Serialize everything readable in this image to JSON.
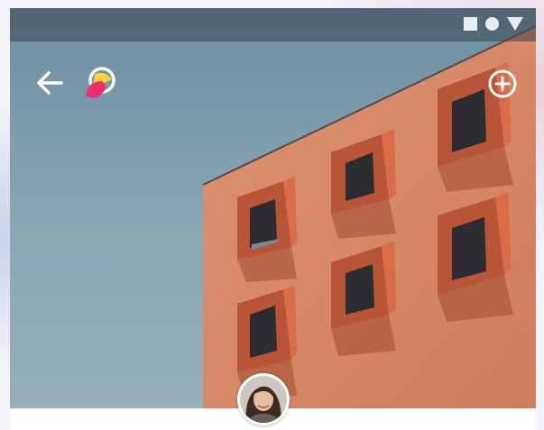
{
  "screen": {
    "title": ""
  },
  "status_bar": {
    "icons": [
      "square-icon",
      "circle-icon",
      "triangle-icon"
    ],
    "icon_color": "#e9eef2"
  },
  "toolbar": {
    "back_icon": "arrow-left-icon",
    "logo_icon": "brand-logo-icon",
    "add_icon": "plus-circle-icon"
  },
  "hero": {
    "image_description_icon": "building-photo",
    "sky_color": "#7d9bad",
    "wall_color": "#d78a6a",
    "window_frame_color": "#c5593c"
  },
  "profile": {
    "avatar_icon": "avatar-photo"
  },
  "colors": {
    "brand_pink": "#ec2d6e",
    "brand_yellow": "#f6d43a"
  }
}
